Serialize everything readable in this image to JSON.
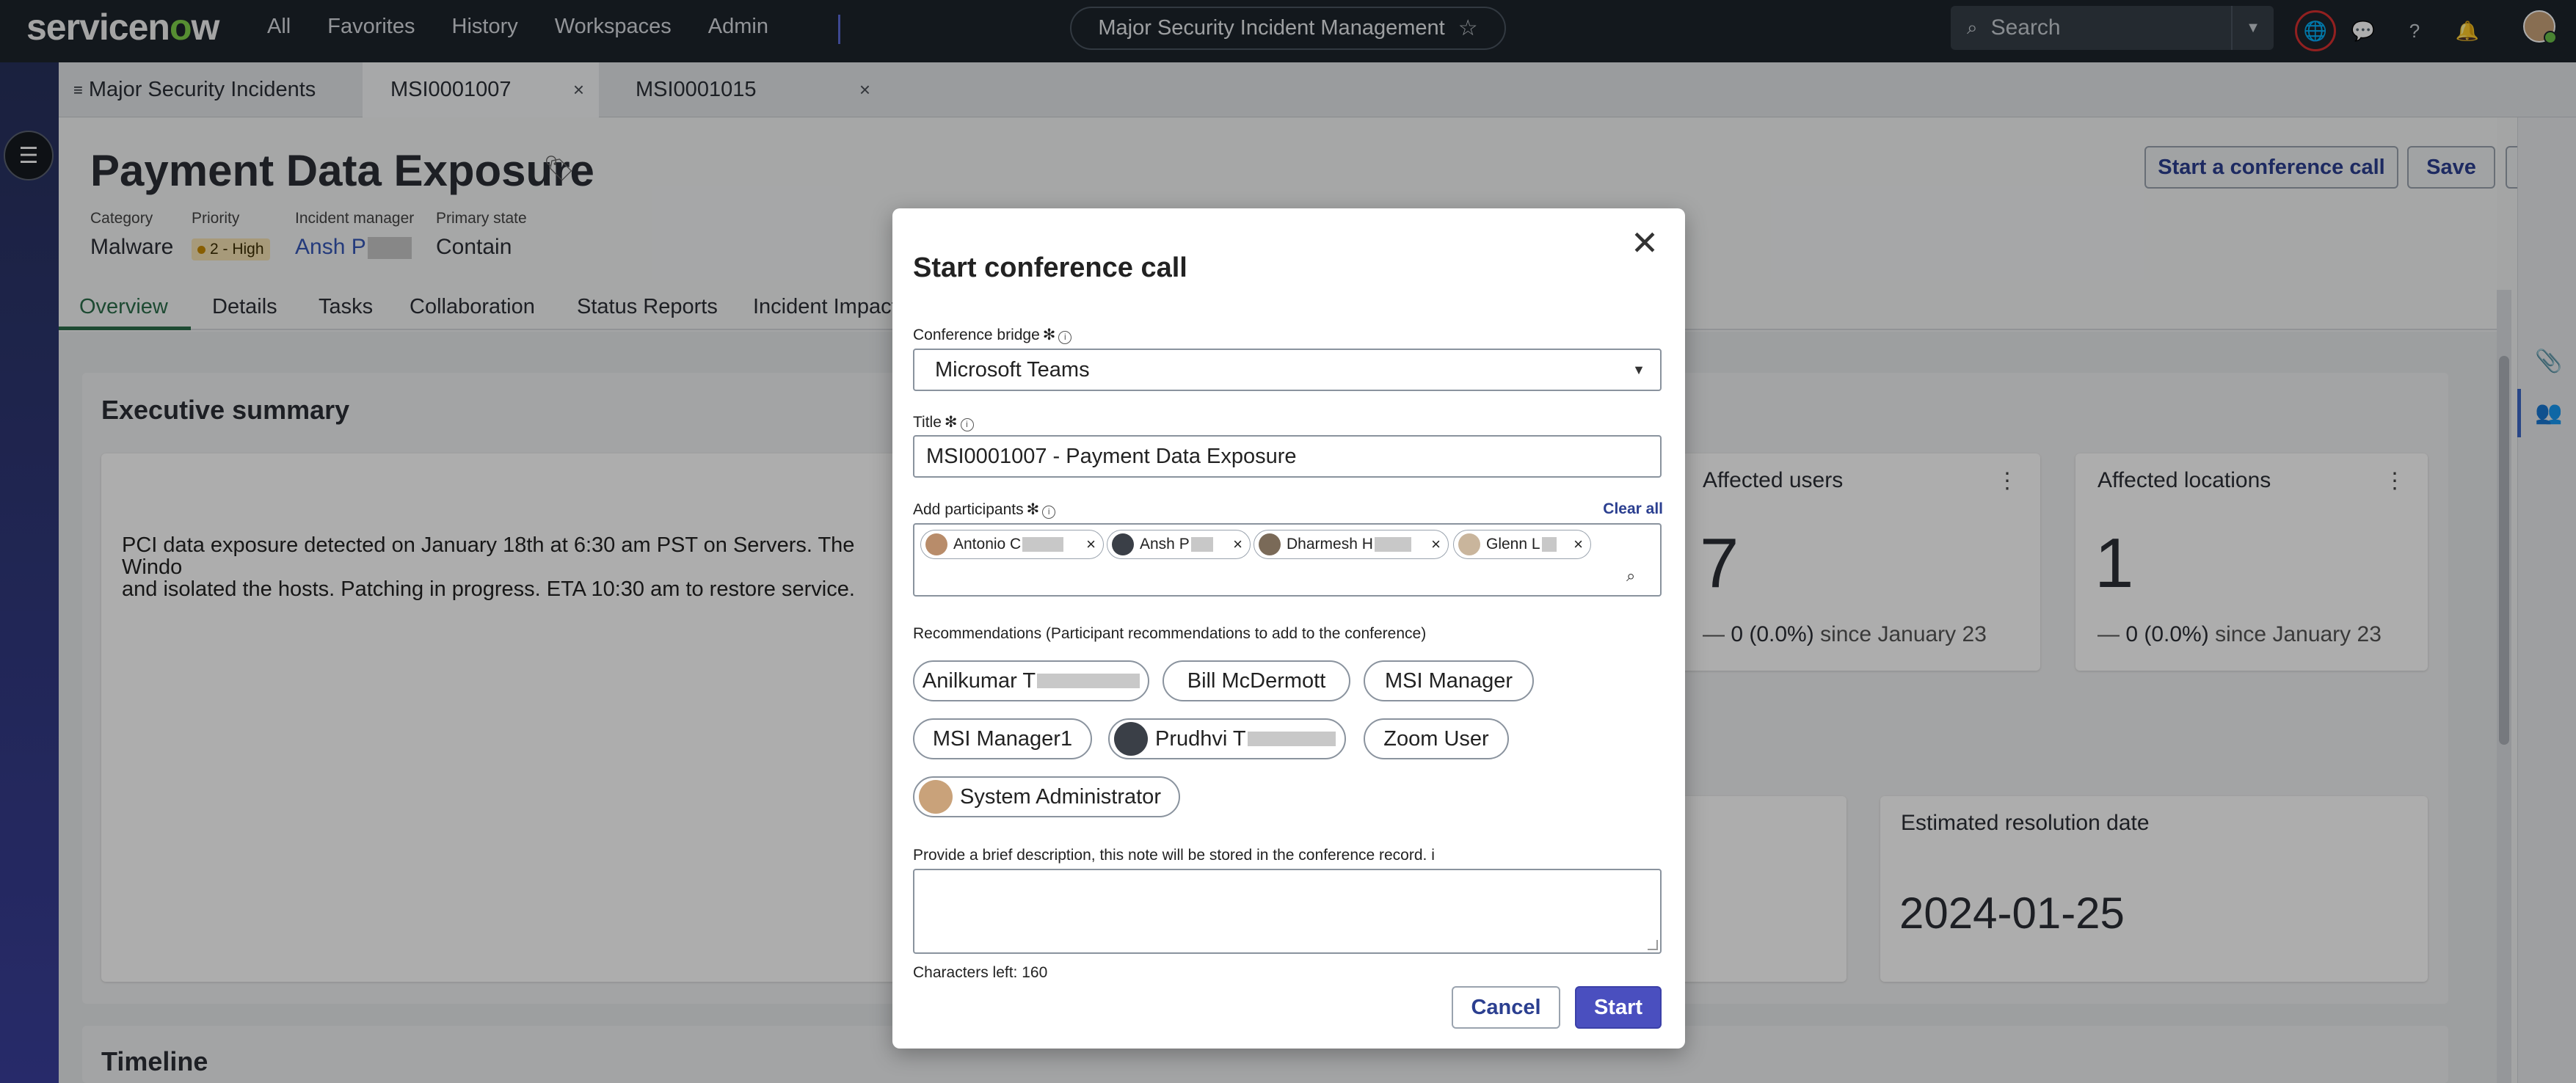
{
  "topbar": {
    "logo": "servicenow",
    "nav": [
      "All",
      "Favorites",
      "History",
      "Workspaces",
      "Admin"
    ],
    "workspace_title": "Major Security Incident Management",
    "search_placeholder": "Search"
  },
  "tabs": [
    {
      "label": "Major Security Incidents"
    },
    {
      "label": "MSI0001007",
      "active": true
    },
    {
      "label": "MSI0001015"
    }
  ],
  "record": {
    "title": "Payment Data Exposure",
    "meta": [
      {
        "label": "Category",
        "value": "Malware"
      },
      {
        "label": "Priority",
        "value": "2 - High"
      },
      {
        "label": "Incident manager",
        "value": "Ansh P"
      },
      {
        "label": "Primary state",
        "value": "Contain"
      }
    ],
    "buttons": {
      "conference": "Start a conference call",
      "save": "Save",
      "more": "⋮"
    }
  },
  "subtabs": [
    "Overview",
    "Details",
    "Tasks",
    "Collaboration",
    "Status Reports",
    "Incident Impact"
  ],
  "overview": {
    "exec_title": "Executive summary",
    "summary_line1": "PCI data exposure detected on January 18th at 6:30 am PST on Servers. The Windo",
    "summary_line2": "and isolated the hosts. Patching in progress. ETA 10:30 am to restore service.",
    "kpis": [
      {
        "title": "Affected users",
        "value": "7",
        "delta": "0 (0.0%)",
        "since": "since January 23"
      },
      {
        "title": "Affected locations",
        "value": "1",
        "delta": "0 (0.0%)",
        "since": "since January 23"
      }
    ],
    "est_title": "Estimated resolution date",
    "est_value": "2024-01-25",
    "timeline_title": "Timeline"
  },
  "dialog": {
    "title": "Start conference call",
    "bridge_label": "Conference bridge",
    "bridge_value": "Microsoft Teams",
    "title_label": "Title",
    "title_value": "MSI0001007 - Payment Data Exposure",
    "participants_label": "Add participants",
    "clear_all": "Clear all",
    "participants": [
      "Antonio C",
      "Ansh P",
      "Dharmesh H",
      "Glenn L"
    ],
    "recommendations_label": "Recommendations (Participant recommendations to add to the conference)",
    "recommendations": [
      "Anilkumar T",
      "Bill McDermott",
      "MSI Manager",
      "MSI Manager1",
      "Prudhvi T",
      "Zoom User",
      "System Administrator"
    ],
    "note_label": "Provide a brief description, this note will be stored in the conference record.",
    "chars_left": "Characters left: 160",
    "cancel": "Cancel",
    "start": "Start"
  },
  "colors": {
    "accent": "#4a4fbf",
    "topbar": "#1d242b",
    "link": "#3657b7"
  }
}
